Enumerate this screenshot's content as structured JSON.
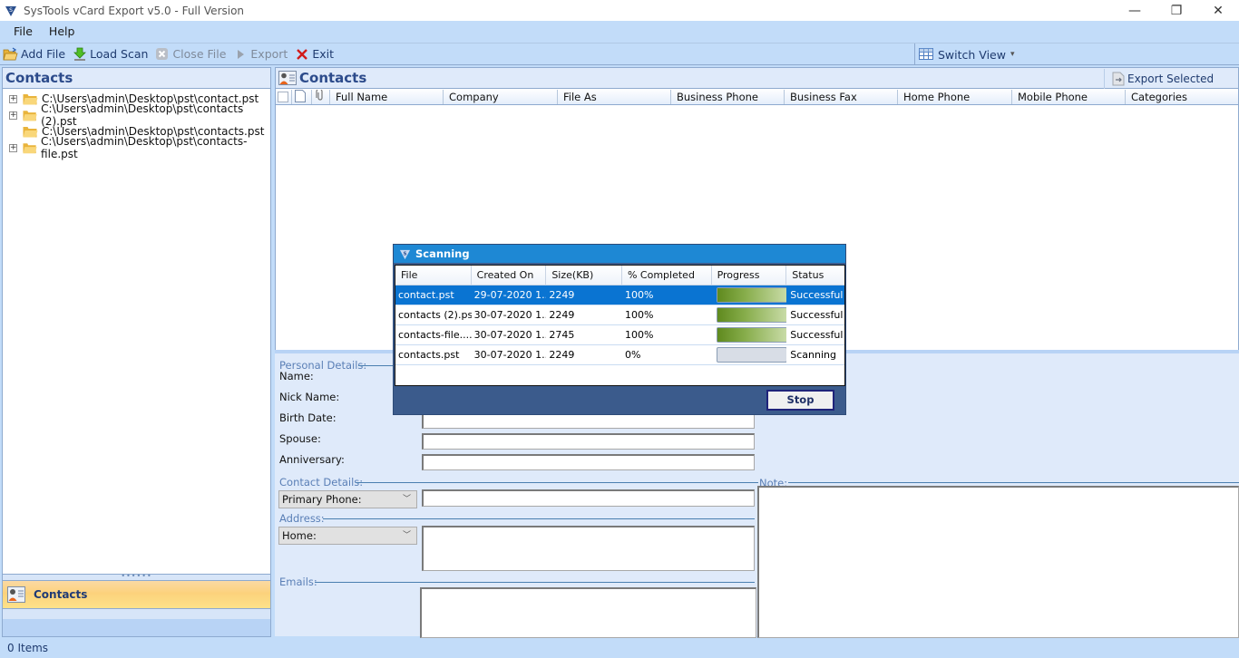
{
  "window": {
    "title": "SysTools  vCard Export v5.0  - Full Version",
    "controls": {
      "minimize": "—",
      "restore": "❐",
      "close": "✕"
    }
  },
  "menubar": {
    "items": [
      {
        "label": "File"
      },
      {
        "label": "Help"
      }
    ]
  },
  "toolbar": {
    "add_file": "Add File",
    "load_scan": "Load Scan",
    "close_file": "Close File",
    "export": "Export",
    "exit": "Exit",
    "switch_view": "Switch View",
    "switch_view_arrow": "▾"
  },
  "left_panel": {
    "header": "Contacts",
    "tree": [
      {
        "path": "C:\\Users\\admin\\Desktop\\pst\\contact.pst",
        "expandable": true
      },
      {
        "path": "C:\\Users\\admin\\Desktop\\pst\\contacts (2).pst",
        "expandable": true
      },
      {
        "path": "C:\\Users\\admin\\Desktop\\pst\\contacts.pst",
        "expandable": false
      },
      {
        "path": "C:\\Users\\admin\\Desktop\\pst\\contacts-file.pst",
        "expandable": true
      }
    ],
    "splitter_grip": "••••••",
    "nav_button": "Contacts"
  },
  "right_panel": {
    "header": "Contacts",
    "export_selected": "Export Selected",
    "columns": [
      "Full Name",
      "Company",
      "File As",
      "Business Phone",
      "Business Fax",
      "Home Phone",
      "Mobile Phone",
      "Categories"
    ]
  },
  "details": {
    "personal_group": "Personal Details:",
    "name_label": "Name:",
    "nick_label": "Nick Name:",
    "birth_label": "Birth Date:",
    "spouse_label": "Spouse:",
    "anniversary_label": "Anniversary:",
    "contact_group": "Contact Details:",
    "phone_select": "Primary Phone:",
    "address_group": "Address:",
    "address_select": "Home:",
    "emails_group": "Emails:",
    "note_group": "Note:",
    "chevron": "﹀"
  },
  "status": {
    "items": "0 Items"
  },
  "scan_dialog": {
    "title": "Scanning",
    "columns": [
      "File",
      "Created On",
      "Size(KB)",
      "% Completed",
      "Progress",
      "Status"
    ],
    "rows": [
      {
        "file": "contact.pst",
        "created": "29-07-2020 1...",
        "size": "2249",
        "percent": "100%",
        "progress": 1.0,
        "status": "Successful",
        "selected": true
      },
      {
        "file": "contacts (2).pst",
        "created": "30-07-2020 1...",
        "size": "2249",
        "percent": "100%",
        "progress": 1.0,
        "status": "Successful",
        "selected": false
      },
      {
        "file": "contacts-file....",
        "created": "30-07-2020 1...",
        "size": "2745",
        "percent": "100%",
        "progress": 1.0,
        "status": "Successful",
        "selected": false
      },
      {
        "file": "contacts.pst",
        "created": "30-07-2020 1...",
        "size": "2249",
        "percent": "0%",
        "progress": 0.0,
        "status": "Scanning",
        "selected": false
      }
    ],
    "stop_label": "Stop"
  }
}
